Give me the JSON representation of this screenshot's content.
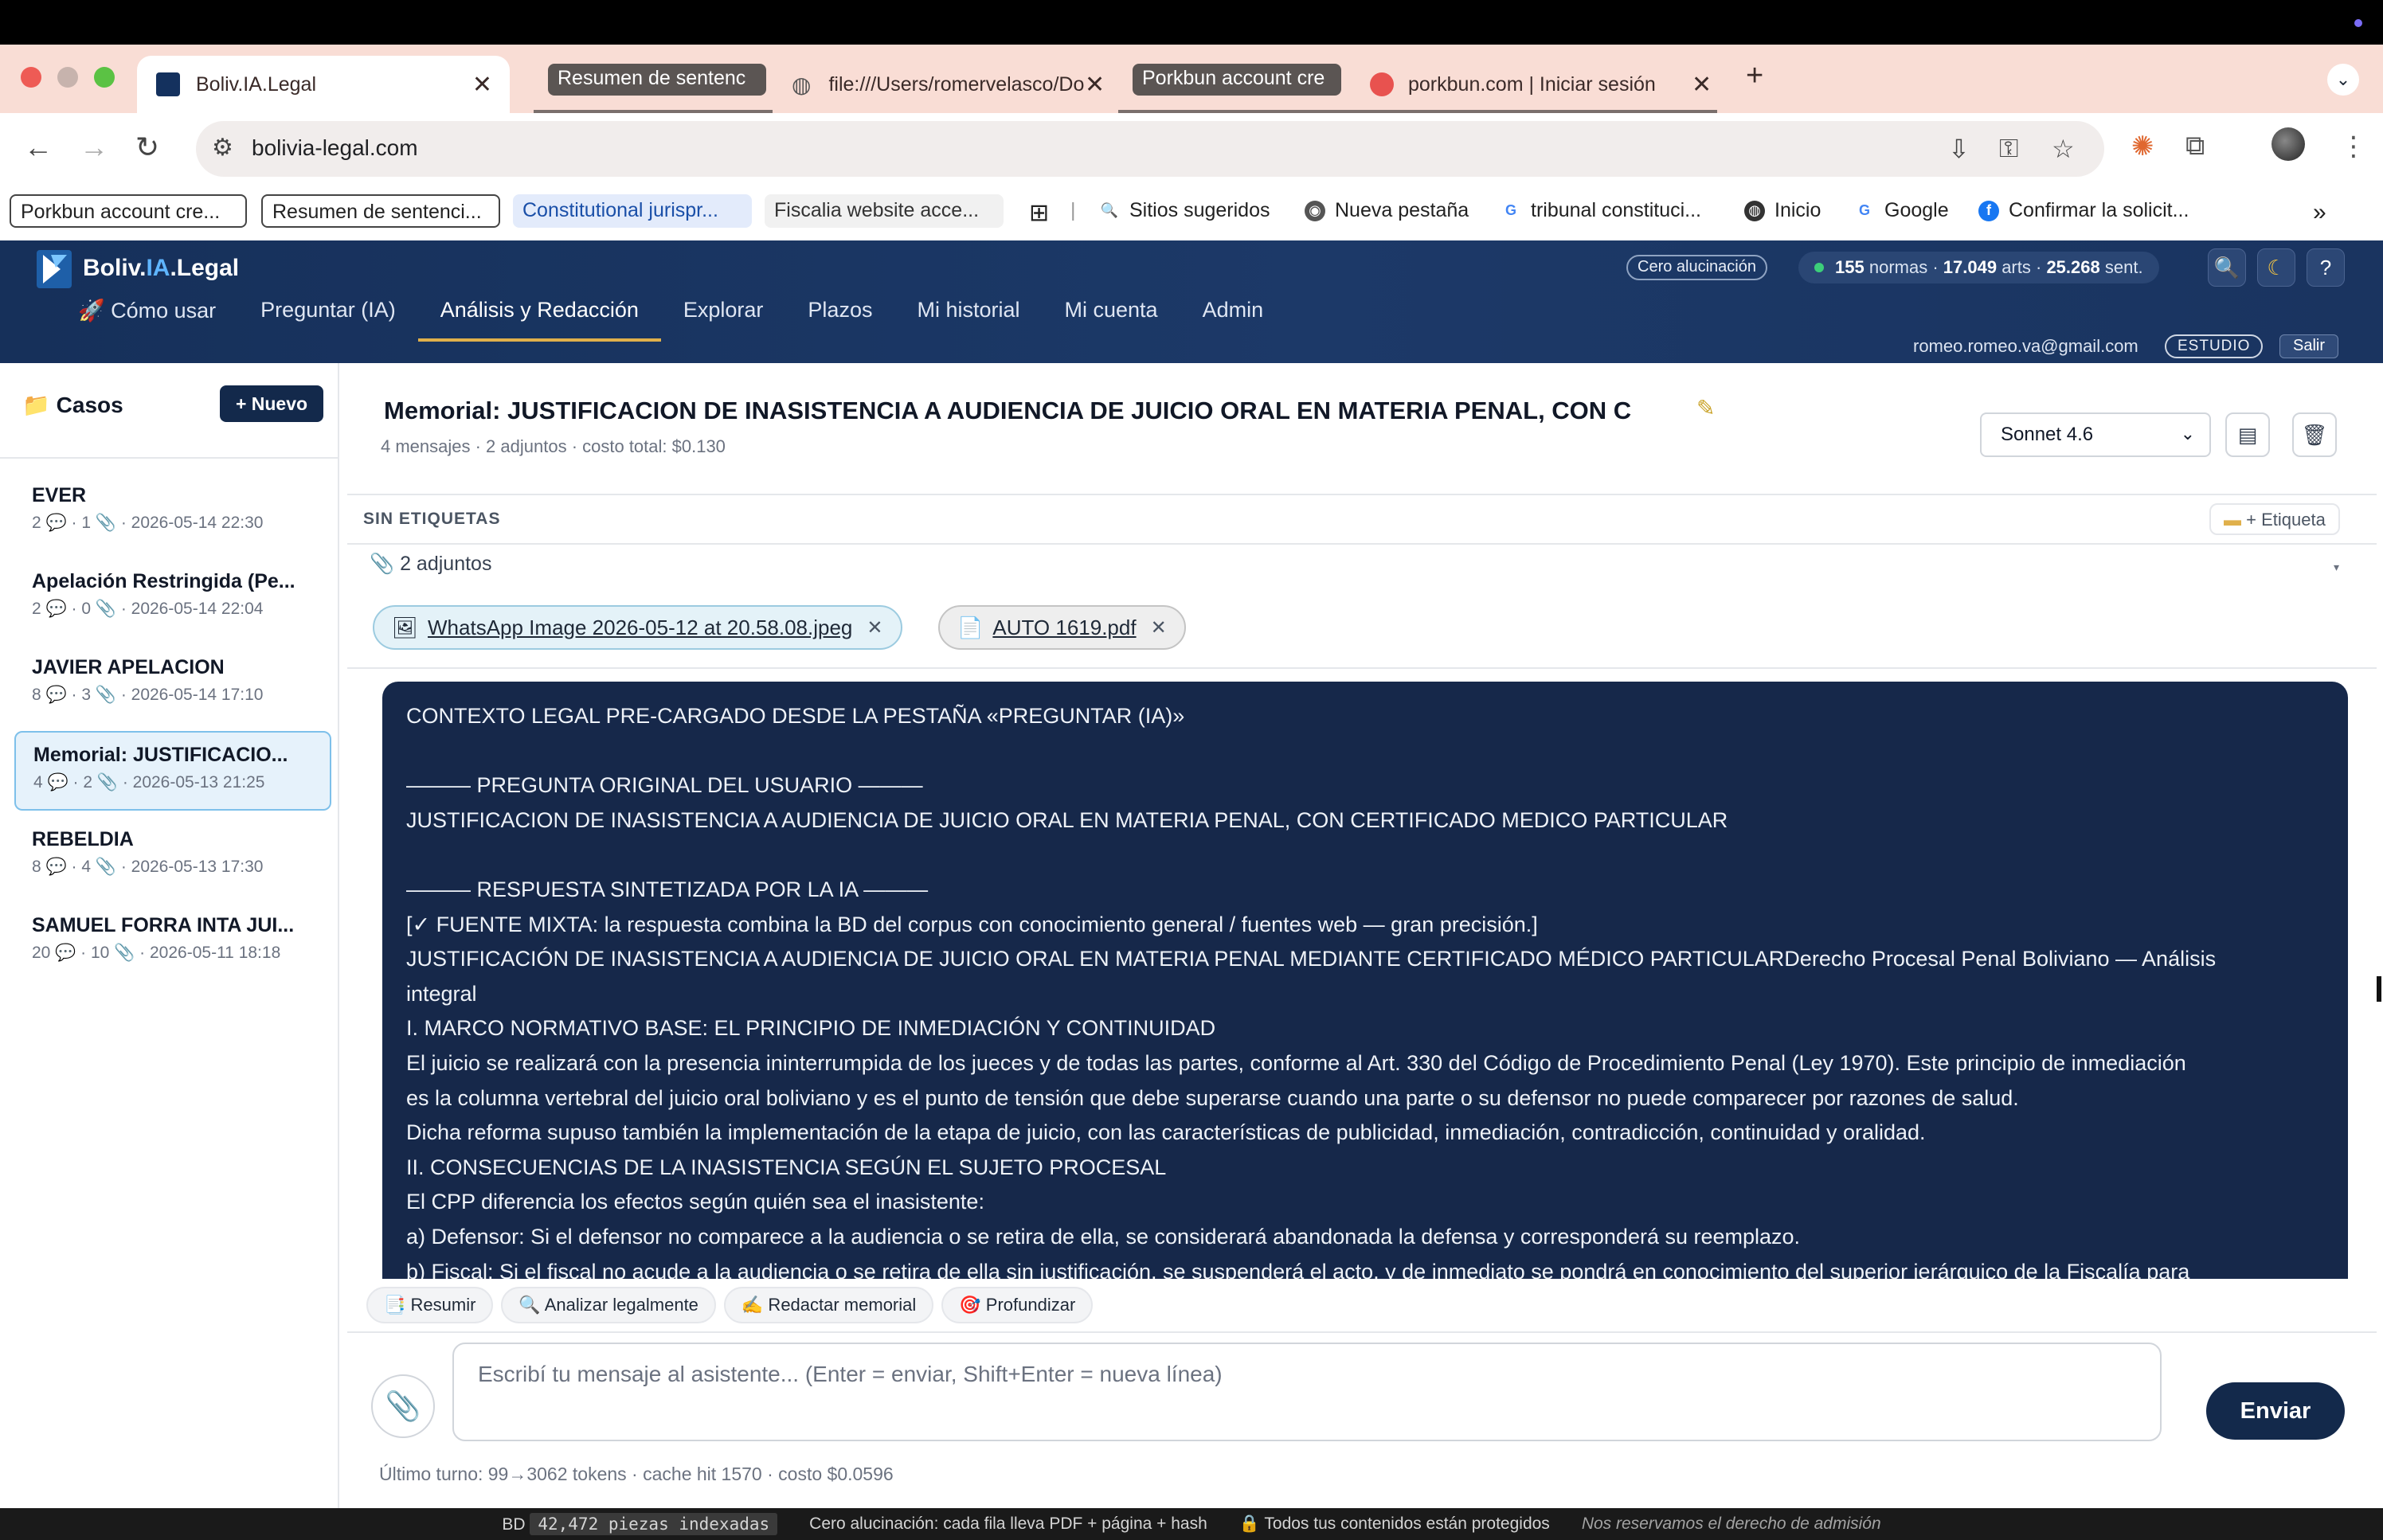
{
  "browser": {
    "tabs": [
      {
        "label": "Boliv.IA.Legal",
        "active": true
      },
      {
        "label": "Resumen de sentenc",
        "group": true
      },
      {
        "label": "file:///Users/romervelasco/Do"
      },
      {
        "label": "Porkbun account cre",
        "group": true
      },
      {
        "label": "porkbun.com | Iniciar sesión"
      }
    ],
    "url": "bolivia-legal.com",
    "bookmarks": [
      "Porkbun account cre...",
      "Resumen de sentenci...",
      "Constitutional jurispr...",
      "Fiscalia website acce...",
      "Sitios sugeridos",
      "Nueva pestaña",
      "tribunal constituci...",
      "Inicio",
      "Google",
      "Confirmar la solicit..."
    ]
  },
  "app": {
    "brand_main": "Boliv.",
    "brand_ia": "IA",
    "brand_tail": ".Legal",
    "nav": [
      "🚀 Cómo usar",
      "Preguntar (IA)",
      "Análisis y Redacción",
      "Explorar",
      "Plazos",
      "Mi historial",
      "Mi cuenta",
      "Admin"
    ],
    "active_nav_index": 2,
    "badge_cero": "Cero alucinación",
    "stats": {
      "normas": "155",
      "normas_label": "normas",
      "arts": "17.049",
      "arts_label": "arts",
      "sent": "25.268",
      "sent_label": "sent."
    },
    "user_email": "romeo.romeo.va@gmail.com",
    "role": "ESTUDIO",
    "logout": "Salir"
  },
  "sidebar": {
    "title": "Casos",
    "new_button": "+ Nuevo",
    "cases": [
      {
        "title": "EVER",
        "meta": "2 💬 · 1 📎 · 2026-05-14 22:30"
      },
      {
        "title": "Apelación Restringida (Pe...",
        "meta": "2 💬 · 0 📎 · 2026-05-14 22:04"
      },
      {
        "title": "JAVIER APELACION",
        "meta": "8 💬 · 3 📎 · 2026-05-14 17:10"
      },
      {
        "title": "Memorial: JUSTIFICACIO...",
        "meta": "4 💬 · 2 📎 · 2026-05-13 21:25",
        "active": true
      },
      {
        "title": "REBELDIA",
        "meta": "8 💬 · 4 📎 · 2026-05-13 17:30"
      },
      {
        "title": "SAMUEL FORRA INTA JUI...",
        "meta": "20 💬 · 10 📎 · 2026-05-11 18:18"
      }
    ]
  },
  "conversation": {
    "title": "Memorial: JUSTIFICACION DE INASISTENCIA A AUDIENCIA DE JUICIO ORAL EN MATERIA PENAL, CON C",
    "meta": "4 mensajes · 2 adjuntos · costo total: $0.130",
    "model": "Sonnet 4.6",
    "tags_label": "SIN ETIQUETAS",
    "tag_button": "+ Etiqueta",
    "attachments_label": "📎 2 adjuntos",
    "attachments": [
      {
        "name": "WhatsApp Image 2026-05-12 at 20.58.08.jpeg",
        "icon": "image-icon"
      },
      {
        "name": "AUTO 1619.pdf",
        "icon": "document-icon"
      }
    ],
    "message_lines": [
      "CONTEXTO LEGAL PRE-CARGADO DESDE LA PESTAÑA «PREGUNTAR (IA)»",
      "",
      "——— PREGUNTA ORIGINAL DEL USUARIO ———",
      "JUSTIFICACION DE INASISTENCIA A AUDIENCIA DE JUICIO ORAL EN MATERIA PENAL, CON CERTIFICADO MEDICO PARTICULAR",
      "",
      "——— RESPUESTA SINTETIZADA POR LA IA ———",
      "[✓ FUENTE MIXTA: la respuesta combina la BD del corpus con conocimiento general / fuentes web — gran precisión.]",
      "JUSTIFICACIÓN DE INASISTENCIA A AUDIENCIA DE JUICIO ORAL EN MATERIA PENAL MEDIANTE CERTIFICADO MÉDICO PARTICULARDerecho Procesal Penal Boliviano — Análisis",
      "integral",
      "I. MARCO NORMATIVO BASE: EL PRINCIPIO DE INMEDIACIÓN Y CONTINUIDAD",
      "El juicio se realizará con la presencia ininterrumpida de los jueces y de todas las partes, conforme al Art. 330 del Código de Procedimiento Penal (Ley 1970). Este principio de inmediación",
      "es la columna vertebral del juicio oral boliviano y es el punto de tensión que debe superarse cuando una parte o su defensor no puede comparecer por razones de salud.",
      "Dicha reforma supuso también la implementación de la etapa de juicio, con las características de publicidad, inmediación, contradicción, continuidad y oralidad.",
      "II. CONSECUENCIAS DE LA INASISTENCIA SEGÚN EL SUJETO PROCESAL",
      "El CPP diferencia los efectos según quién sea el inasistente:",
      "a) Defensor: Si el defensor no comparece a la audiencia o se retira de ella, se considerará abandonada la defensa y corresponderá su reemplazo.",
      "b) Fiscal: Si el fiscal no acude a la audiencia o se retira de ella sin justificación, se suspenderá el acto, y de inmediato se pondrá en conocimiento del superior jerárquico de la Fiscalía para"
    ],
    "actions": [
      "📑 Resumir",
      "🔍 Analizar legalmente",
      "✍️ Redactar memorial",
      "🎯 Profundizar"
    ],
    "composer_placeholder": "Escribí tu mensaje al asistente... (Enter = enviar, Shift+Enter = nueva línea)",
    "send": "Enviar",
    "turn_info": "Último turno: 99→3062 tokens · cache hit 1570 · costo $0.0596"
  },
  "footer": {
    "bd_label": "BD",
    "bd_value": "42,472 piezas indexadas",
    "note1": "Cero alucinación: cada fila lleva PDF + página + hash",
    "note2": "🔒 Todos tus contenidos están protegidos",
    "note3": "Nos reservamos el derecho de admisión"
  },
  "colors": {
    "header_bg": "#1c3968",
    "message_bg": "#16284a",
    "primary_button": "#13294b",
    "active_nav_underline": "#e0b04b",
    "tab_bar": "#f9ddd5"
  }
}
